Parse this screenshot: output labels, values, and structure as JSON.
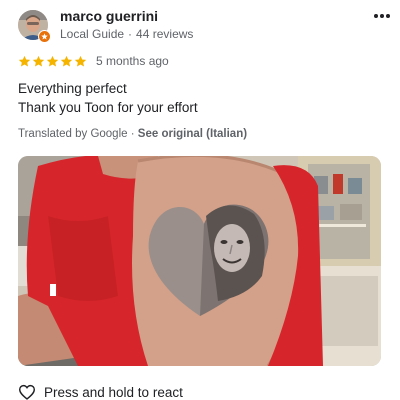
{
  "review": {
    "user": {
      "name": "marco guerrini",
      "role": "Local Guide",
      "separator": "·",
      "reviews_count": "44 reviews"
    },
    "rating": 5,
    "rating_max": 5,
    "date": "5 months ago",
    "text_lines": [
      "Everything perfect",
      "Thank you Toon for your effort"
    ],
    "translation": {
      "label": "Translated by Google",
      "separator": "·",
      "link": "See original (Italian)"
    },
    "react_label": "Press and hold to react"
  },
  "colors": {
    "star": "#f4b400",
    "badge": "#e8710a",
    "text_primary": "#202124",
    "text_secondary": "#5f6368",
    "shirt": "#d6262b"
  },
  "icons": {
    "more": "more-vert-icon",
    "badge": "local-guide-badge-icon",
    "star": "star-icon",
    "react": "heart-outline-icon"
  }
}
